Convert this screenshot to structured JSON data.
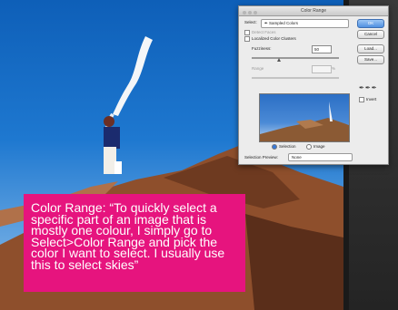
{
  "dialog": {
    "title": "Color Range",
    "select_label": "Select:",
    "select_value": "Sampled Colors",
    "detect_faces_label": "Detect Faces",
    "localized_label": "Localized Color Clusters",
    "fuzziness_label": "Fuzziness:",
    "fuzziness_value": "50",
    "range_label": "Range",
    "range_unit": "%",
    "selection_label": "Selection",
    "image_label": "Image",
    "preview_label": "Selection Preview:",
    "preview_value": "None",
    "buttons": [
      "OK",
      "Cancel",
      "Load...",
      "Save..."
    ],
    "invert_label": "Invert"
  },
  "caption": {
    "heading": "Color Range:",
    "body": "“To quickly select a specific part of an image that is mostly one colour, I simply go to Select>Color Range and pick the color I want to select. I usually use this to select skies”"
  },
  "colors": {
    "caption_bg": "#e6147e",
    "sky": "#1e78d0",
    "rock": "#a0603a"
  },
  "icons": [
    "eyedropper-icon",
    "eyedropper-plus-icon",
    "eyedropper-minus-icon"
  ]
}
